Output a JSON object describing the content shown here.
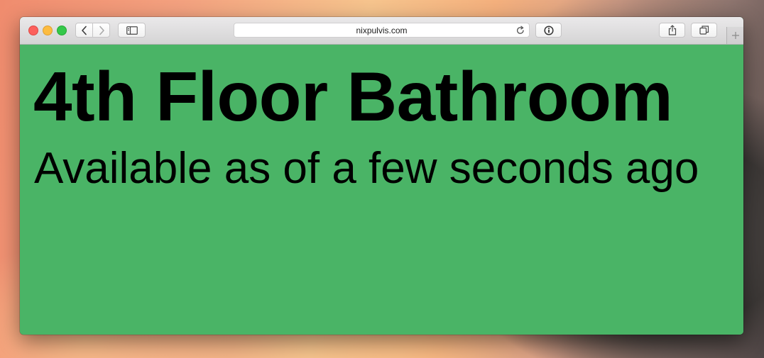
{
  "browser": {
    "address_bar": {
      "url": "nixpulvis.com"
    },
    "icons": {
      "back": "chevron-left-icon",
      "forward": "chevron-right-icon",
      "sidebar": "sidebar-icon",
      "reload": "reload-icon",
      "page_info": "info-icon",
      "share": "share-icon",
      "tabs": "tabs-overview-icon",
      "new_tab": "plus-icon"
    }
  },
  "page": {
    "title": "4th Floor Bathroom",
    "status": "Available as of a few seconds ago",
    "background_color": "#4ab466"
  }
}
